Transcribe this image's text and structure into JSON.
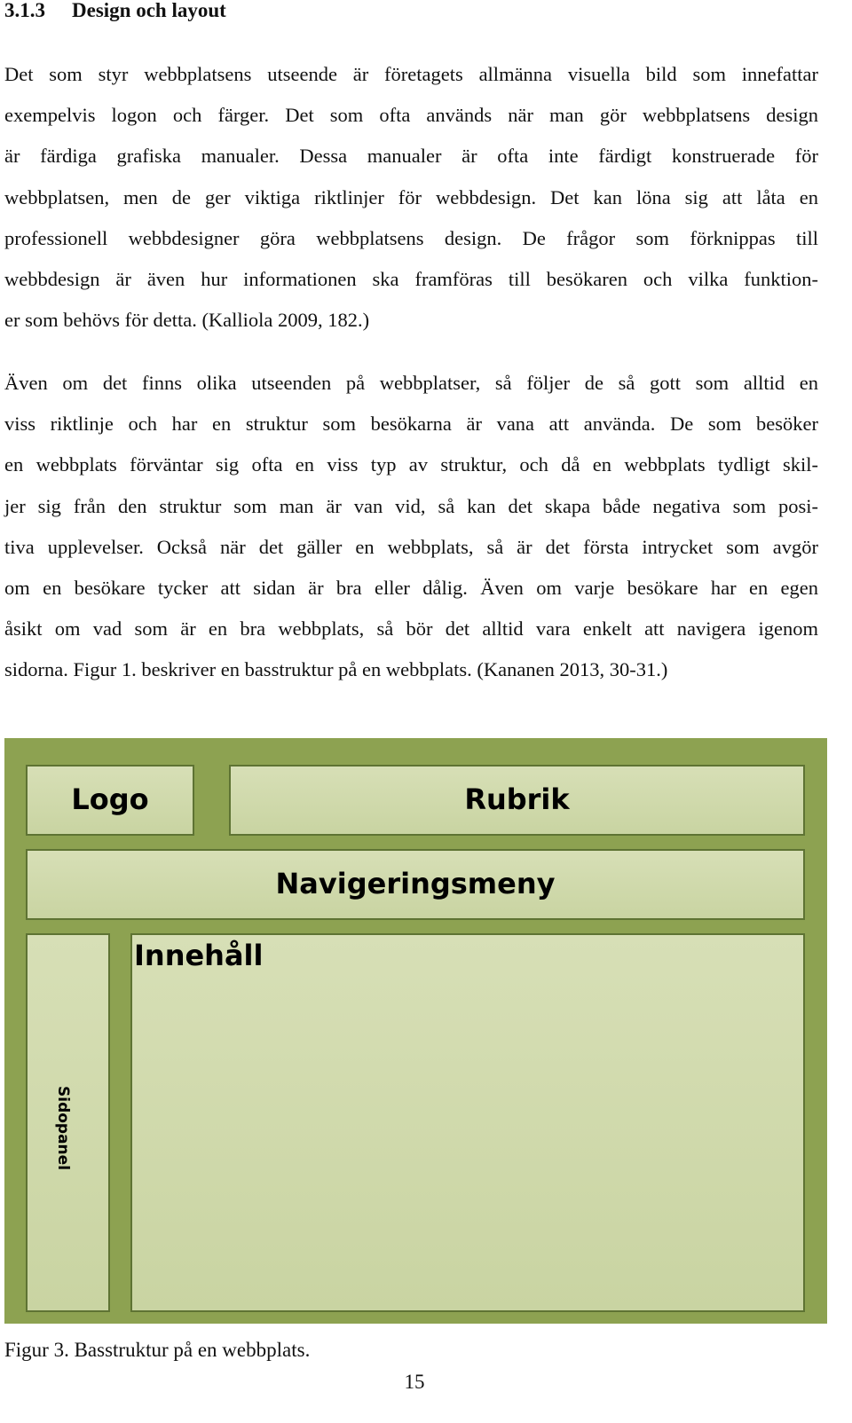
{
  "heading": {
    "number": "3.1.3",
    "title": "Design och layout"
  },
  "paragraphs": [
    [
      "Det som styr webbplatsens utseende är företagets allmänna visuella bild som innefattar",
      "exempelvis logon och färger. Det som ofta används när man gör webbplatsens design",
      "är färdiga grafiska manualer. Dessa manualer är ofta inte färdigt konstruerade för",
      "webbplatsen, men de ger viktiga riktlinjer för webbdesign. Det kan löna sig att låta en",
      "professionell webbdesigner göra webbplatsens design. De frågor som förknippas till",
      "webbdesign är även hur informationen ska framföras till besökaren och vilka funktion-",
      "er som behövs för detta. (Kalliola 2009, 182.)"
    ],
    [
      "Även om det finns olika utseenden på webbplatser, så följer de så gott som alltid en",
      "viss riktlinje och har en struktur som besökarna är vana att använda. De som besöker",
      "en webbplats förväntar sig ofta en viss typ av struktur, och då en webbplats tydligt skil-",
      "jer sig från den struktur som man är van vid, så kan det skapa både negativa som posi-",
      "tiva upplevelser. Också när det gäller en webbplats, så är det första intrycket som avgör",
      "om en besökare tycker att sidan är bra eller dålig. Även om varje besökare har en egen",
      "åsikt om vad som är en bra webbplats, så bör det alltid vara enkelt att navigera igenom",
      "sidorna. Figur 1. beskriver en basstruktur på en webbplats. (Kananen 2013, 30-31.)"
    ]
  ],
  "figure": {
    "logo": "Logo",
    "rubrik": "Rubrik",
    "nav": "Navigeringsmeny",
    "side": "Sidopanel",
    "content": "Innehåll",
    "colors": {
      "frame": "#8da251",
      "box": "#d0d9ab",
      "border": "#5e7333"
    }
  },
  "caption": "Figur 3. Basstruktur på en webbplats.",
  "page_number": "15"
}
